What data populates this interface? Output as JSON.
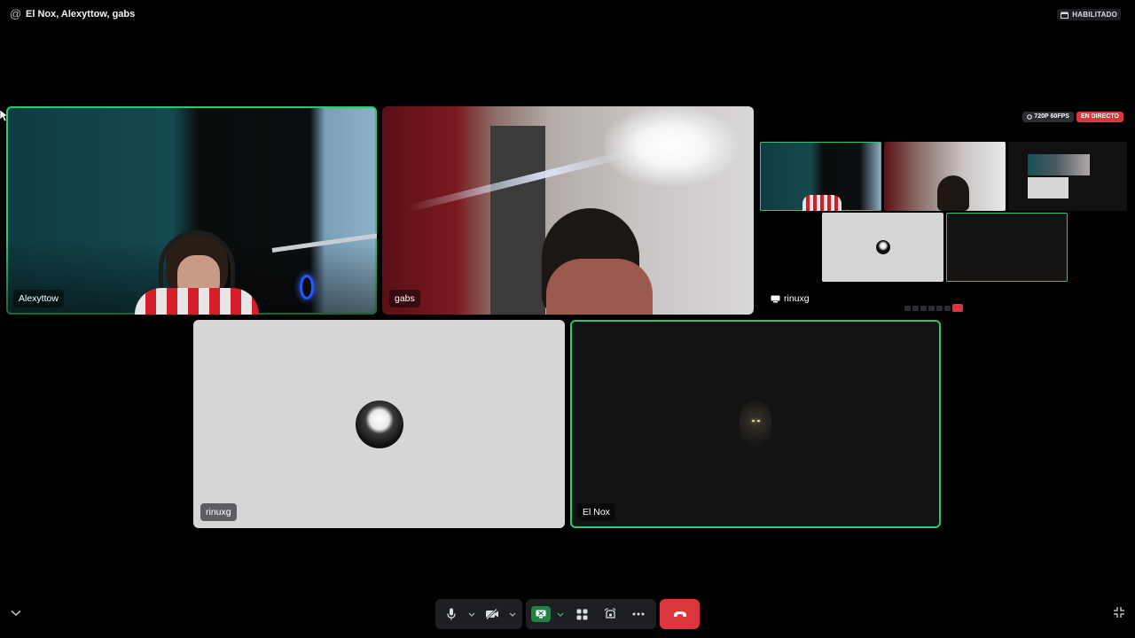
{
  "header": {
    "at_symbol": "@",
    "title": "El Nox, Alexyttow, gabs",
    "status_badge": "HABILITADO"
  },
  "participants": [
    {
      "name": "Alexyttow",
      "type": "camera",
      "speaking": true
    },
    {
      "name": "gabs",
      "type": "camera",
      "speaking": false
    },
    {
      "name": "rinuxg",
      "type": "screen-share",
      "speaking": false
    },
    {
      "name": "rinuxg",
      "type": "avatar",
      "speaking": false
    },
    {
      "name": "El Nox",
      "type": "avatar",
      "speaking": true
    }
  ],
  "stream": {
    "quality": "720P 60FPS",
    "live_label": "EN DIRECTO"
  },
  "controls": {
    "microphone_icon": "microphone-icon",
    "camera_icon": "camera-off-icon",
    "screen_share_icon": "screen-share-icon",
    "activities_icon": "activities-icon",
    "soundboard_icon": "soundboard-icon",
    "more_icon": "more-icon",
    "end_call_icon": "hang-up-icon"
  },
  "colors": {
    "speaking_ring": "#2dc770",
    "end_call": "#da373c",
    "share_active": "#248046",
    "live": "#da373c"
  }
}
